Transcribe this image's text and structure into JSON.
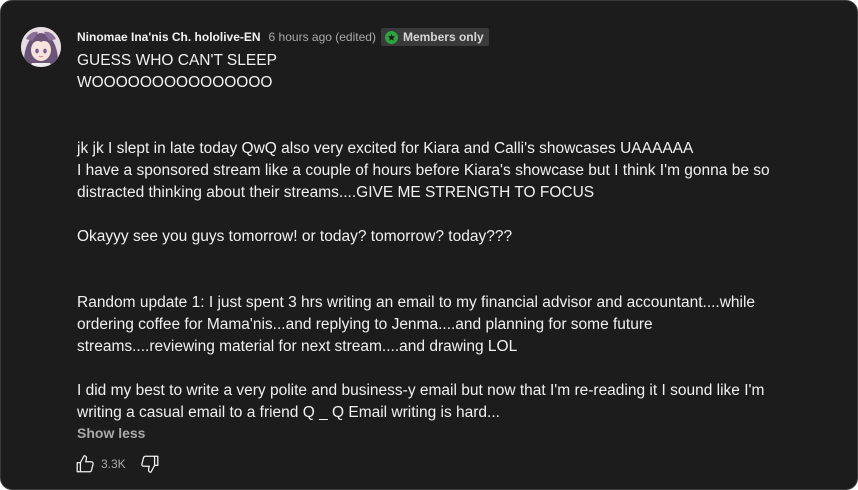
{
  "comment": {
    "author": "Ninomae Ina'nis Ch. hololive-EN",
    "timestamp": "6 hours ago (edited)",
    "badge": "Members only",
    "avatar_icon": "avatar-image",
    "badge_color": "#2ba640",
    "lines": [
      "GUESS WHO CAN'T SLEEP",
      "WOOOOOOOOOOOOOOO",
      "jk jk I slept in late today QwQ also very excited for Kiara and Calli's showcases UAAAAAA",
      "I have a sponsored stream like a couple of hours before Kiara's showcase but I think I'm gonna be so",
      "distracted thinking about their streams....GIVE ME STRENGTH TO FOCUS",
      "Okayyy see you guys tomorrow! or today? tomorrow? today???",
      "Random update 1: I just spent 3 hrs writing an email to my financial advisor and accountant....while",
      "ordering coffee for Mama'nis...and replying to Jenma....and planning for some future",
      "streams....reviewing material for next stream....and drawing LOL",
      "I did my best to write a very polite and business-y email but now that I'm re-reading it I sound like I'm",
      "writing a casual email to a friend Q _ Q Email writing is hard..."
    ],
    "show_less": "Show less",
    "likes": "3.3K",
    "like_icon": "thumbs-up-icon",
    "dislike_icon": "thumbs-down-icon"
  }
}
